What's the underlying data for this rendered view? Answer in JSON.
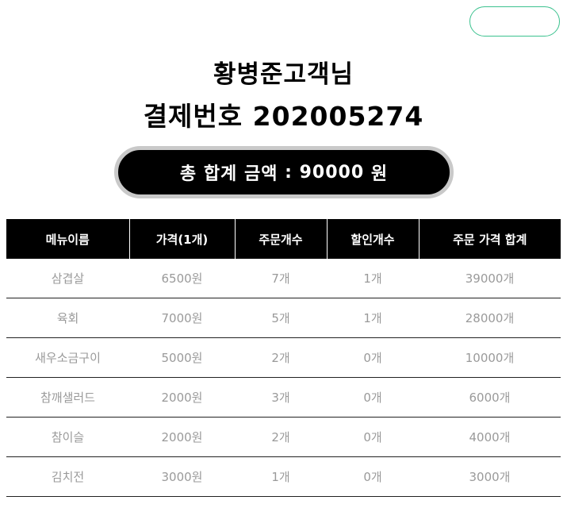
{
  "header": {
    "customer_title": "황병준고객님",
    "payment_label": "결제번호",
    "payment_number": "202005274"
  },
  "total": {
    "label": "총 합계 금액",
    "separator": ":",
    "amount": "90000",
    "unit": "원"
  },
  "table": {
    "headers": [
      "메뉴이름",
      "가격(1개)",
      "주문개수",
      "할인개수",
      "주문 가격 합계"
    ],
    "rows": [
      [
        "삼겹살",
        "6500원",
        "7개",
        "1개",
        "39000개"
      ],
      [
        "육회",
        "7000원",
        "5개",
        "1개",
        "28000개"
      ],
      [
        "새우소금구이",
        "5000원",
        "2개",
        "0개",
        "10000개"
      ],
      [
        "참깨샐러드",
        "2000원",
        "3개",
        "0개",
        "6000개"
      ],
      [
        "참이슬",
        "2000원",
        "2개",
        "0개",
        "4000개"
      ],
      [
        "김치전",
        "3000원",
        "1개",
        "0개",
        "3000개"
      ]
    ]
  },
  "colors": {
    "accent_outline": "#3cc28f",
    "header_bg": "#000000",
    "cell_text": "#9a9a9a"
  }
}
